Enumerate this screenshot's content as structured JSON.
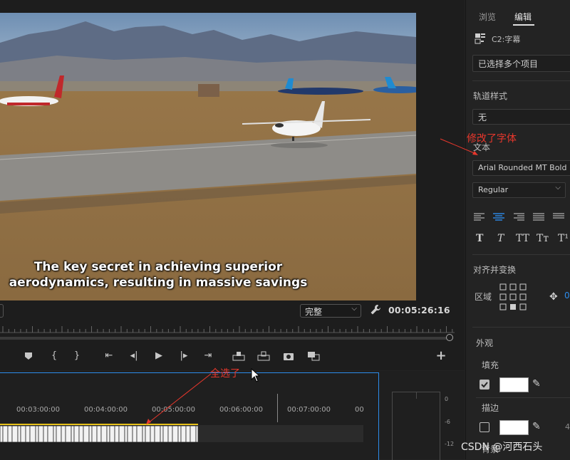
{
  "monitor": {
    "subtitle_line1": "The key secret in achieving superior",
    "subtitle_line2": "aerodynamics, resulting in massive savings",
    "quality": "完整",
    "timecode": "00:05:26:16"
  },
  "transport_icons": [
    "marker-icon",
    "mark-in-icon",
    "mark-out-icon",
    "go-to-in-icon",
    "step-back-icon",
    "play-icon",
    "step-forward-icon",
    "go-to-out-icon",
    "lift-icon",
    "extract-icon",
    "export-frame-icon",
    "compare-icon",
    "add-button-icon"
  ],
  "timeline": {
    "timecodes": [
      "00:03:00:00",
      "00:04:00:00",
      "00:05:00:00",
      "00:06:00:00",
      "00:07:00:00",
      "00"
    ],
    "meter_db": [
      "0",
      "-6",
      "-12"
    ]
  },
  "right_panel": {
    "tabs": [
      "浏览",
      "编辑"
    ],
    "active_tab": "编辑",
    "track_name": "C2:字幕",
    "selection": "已选择多个项目",
    "track_style_label": "轨道样式",
    "track_style_value": "无",
    "text_label": "文本",
    "font_name": "Arial Rounded MT Bold",
    "font_style": "Regular",
    "text_styles": [
      "T",
      "T",
      "TT",
      "Tт",
      "T¹"
    ],
    "align_transform_label": "对齐并变换",
    "region_label": "区域",
    "region_value": "0",
    "appearance_label": "外观",
    "fill_label": "填充",
    "stroke_label": "描边",
    "stroke_value": "4",
    "shadow_label": "背景",
    "fill_color": "#ffffff",
    "stroke_color": "#ffffff"
  },
  "annotations": {
    "font_changed": "修改了字体",
    "select_all": "全选了"
  },
  "watermark": "CSDN @河西石头"
}
